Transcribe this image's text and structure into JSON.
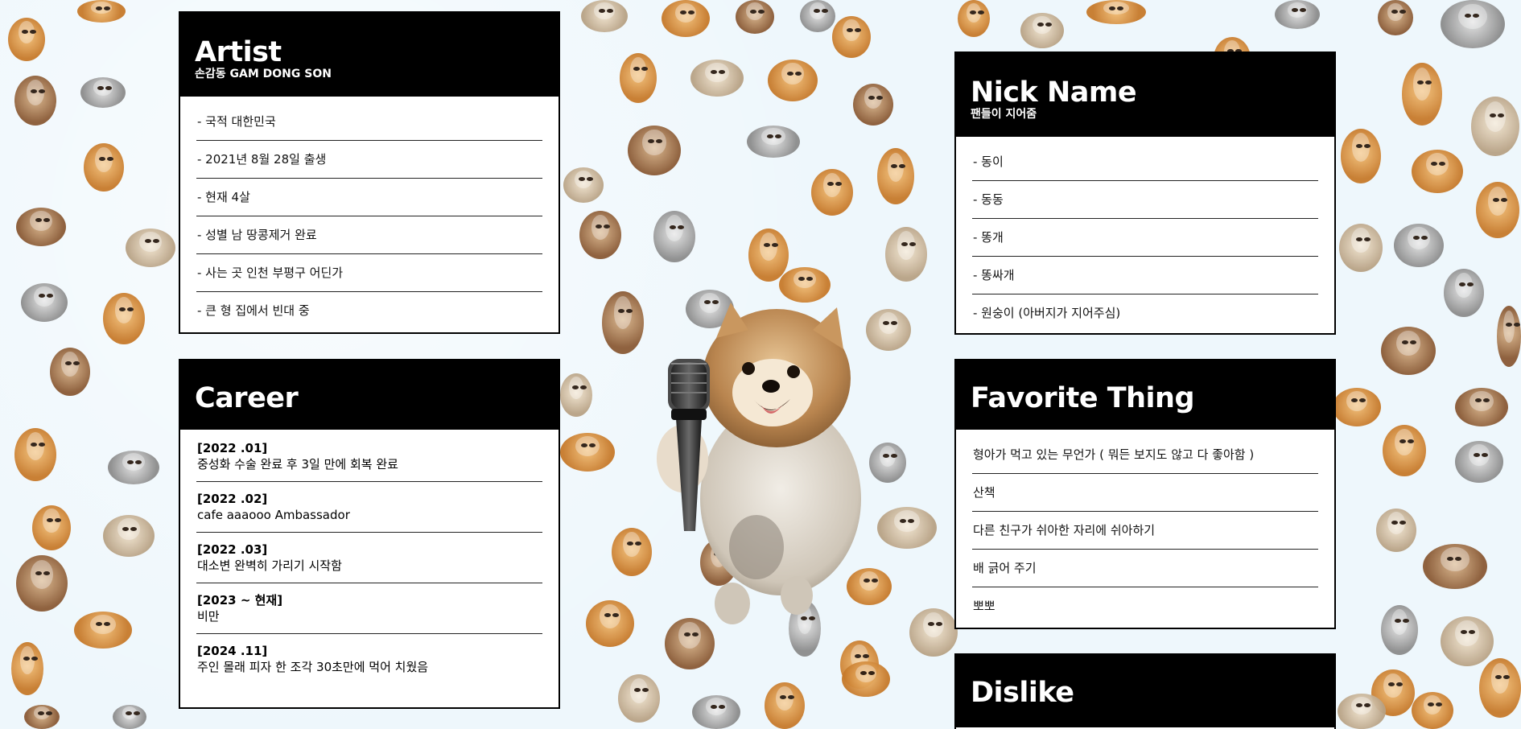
{
  "artist": {
    "title": "Artist",
    "subtitle": "손감동 GAM DONG SON",
    "items": [
      "- 국적 대한민국",
      "- 2021년 8월 28일 출생",
      "- 현재 4살",
      "- 성별 남 땅콩제거 완료",
      "- 사는 곳 인천 부평구 어딘가",
      "- 큰 형 집에서 빈대 중"
    ]
  },
  "career": {
    "title": "Career",
    "items": [
      {
        "date": "[2022 .01]",
        "text": "중성화 수술 완료 후 3일 만에 회복 완료"
      },
      {
        "date": "[2022 .02]",
        "text": "cafe aaaooo Ambassador"
      },
      {
        "date": "[2022 .03]",
        "text": "대소변 완벽히 가리기 시작함"
      },
      {
        "date": "[2023 ~ 현재]",
        "text": "비만"
      },
      {
        "date": "[2024 .11]",
        "text": "주인 몰래 피자 한 조각 30초만에 먹어 치웠음"
      }
    ]
  },
  "nickname": {
    "title": "Nick Name",
    "subtitle": "팬들이 지어줌",
    "items": [
      "- 동이",
      "- 동동",
      "- 똥개",
      "- 똥싸개",
      "- 원숭이 (아버지가 지어주심)"
    ]
  },
  "favorite": {
    "title": "Favorite Thing",
    "items": [
      "형아가 먹고 있는 무언가 ( 뭐든 보지도 않고 다 좋아함 )",
      "산책",
      "다른 친구가 쉬아한 자리에 쉬아하기",
      "배 긁어 주기",
      "뽀뽀"
    ]
  },
  "dislike": {
    "title": "Dislike"
  },
  "colors": {
    "background": "#eef7fc",
    "panel_header": "#000000",
    "panel_body": "#ffffff"
  }
}
